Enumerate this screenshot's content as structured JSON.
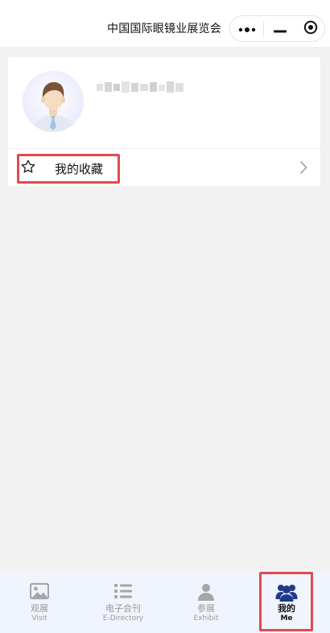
{
  "header": {
    "title": "中国国际眼镜业展览会",
    "more_icon": "more-dots-icon",
    "minimize_icon": "minimize-icon",
    "close_icon": "target-close-icon"
  },
  "profile": {
    "avatar_icon": "user-avatar-icon",
    "username": "(blurred)"
  },
  "favorites": {
    "label": "我的收藏",
    "icon": "star-outline-icon",
    "chevron_icon": "chevron-right-icon"
  },
  "tabbar": {
    "active_color": "#1f3a8a",
    "inactive_color": "#9a9a9a",
    "items": [
      {
        "label": "观展",
        "sublabel": "Visit",
        "icon": "picture-icon",
        "active": false
      },
      {
        "label": "电子会刊",
        "sublabel": "E-Directory",
        "icon": "list-icon",
        "active": false
      },
      {
        "label": "参展",
        "sublabel": "Exhibit",
        "icon": "person-icon",
        "active": false
      },
      {
        "label": "我的",
        "sublabel": "Me",
        "icon": "people-icon",
        "active": true
      }
    ]
  },
  "annotations": {
    "highlight_color": "#e04b4f"
  }
}
